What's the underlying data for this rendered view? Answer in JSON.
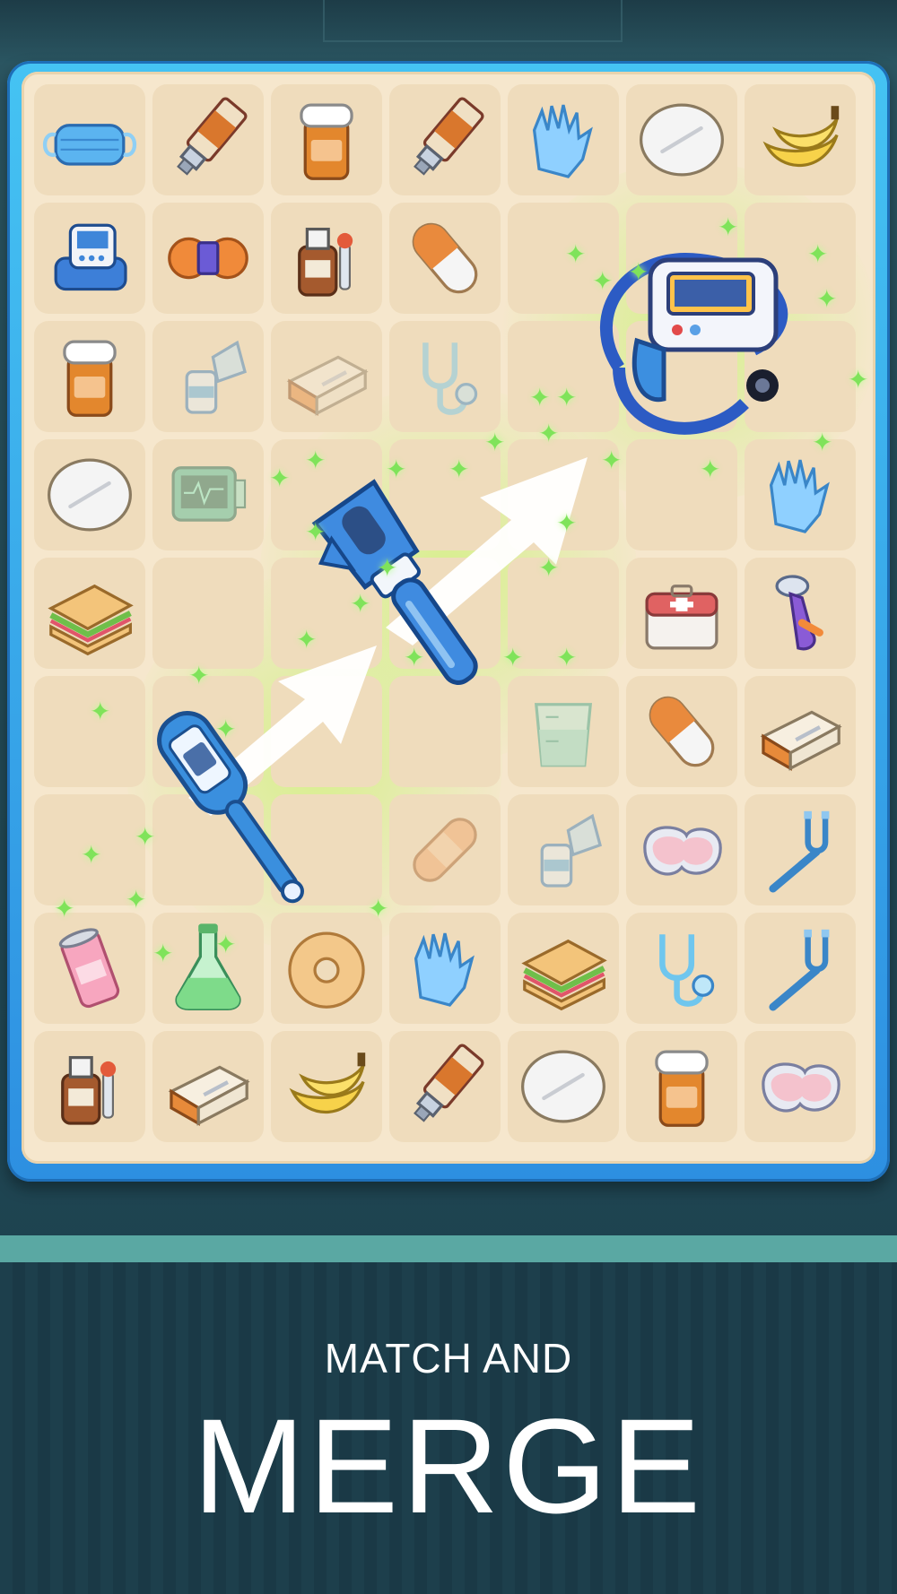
{
  "tagline": {
    "line1": "MATCH AND",
    "line2": "MERGE"
  },
  "board": {
    "columns": 7,
    "rows": 9,
    "tiles": [
      [
        "face-mask-icon",
        "ointment-tube-icon",
        "pill-bottle-icon",
        "ointment-tube-icon",
        "gloves-icon",
        "pill-icon",
        "bananas-icon"
      ],
      [
        "blood-pressure-monitor-icon",
        "bandage-roll-icon",
        "medicine-dropper-bottle-icon",
        "capsule-icon",
        "empty",
        "empty",
        "empty"
      ],
      [
        "pill-bottle-icon",
        "inhaler-icon",
        "medicine-box-icon",
        "stethoscope-icon",
        "empty",
        "empty",
        "empty"
      ],
      [
        "pill-icon",
        "heart-monitor-icon",
        "empty",
        "empty",
        "empty",
        "empty",
        "gloves-icon"
      ],
      [
        "sandwich-icon",
        "empty",
        "empty",
        "empty",
        "empty",
        "first-aid-kit-icon",
        "reflex-hammer-icon"
      ],
      [
        "empty",
        "empty",
        "empty",
        "empty",
        "measuring-cup-icon",
        "capsule-icon",
        "medicine-box-icon"
      ],
      [
        "empty",
        "empty",
        "empty",
        "adhesive-bandage-icon",
        "inhaler-icon",
        "kidney-dish-icon",
        "tuning-fork-icon"
      ],
      [
        "soda-can-icon",
        "flask-icon",
        "bagel-icon",
        "gloves-icon",
        "sandwich-icon",
        "stethoscope-icon",
        "tuning-fork-icon"
      ],
      [
        "medicine-dropper-bottle-icon",
        "medicine-box-icon",
        "bananas-icon",
        "ointment-tube-icon",
        "pill-icon",
        "pill-bottle-icon",
        "kidney-dish-icon"
      ]
    ],
    "merge_chain": [
      "thermometer-icon",
      "otoscope-icon",
      "digital-blood-pressure-monitor-icon"
    ],
    "colors": {
      "frame": "#3aa9ec",
      "board": "#f6e7cd",
      "cell": "#efdcbc",
      "sparkle": "#7fe35a",
      "accent_band": "#5aa8a3"
    }
  }
}
